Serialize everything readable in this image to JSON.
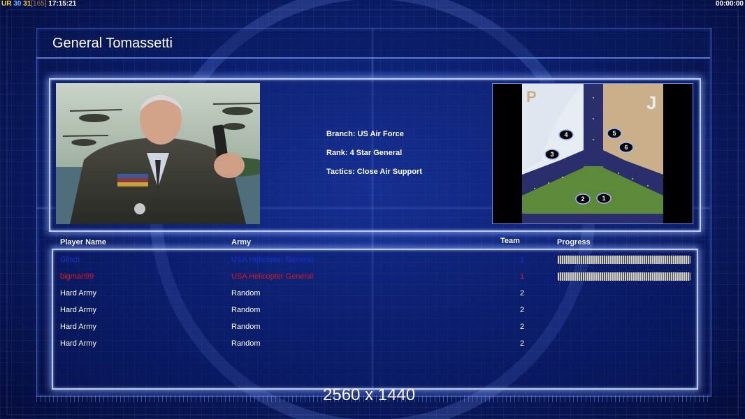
{
  "hud": {
    "ur": "UR",
    "n1": "30",
    "n2": "31",
    "n3": "[165]",
    "clock": "17:15:21",
    "timer": "00:00:00"
  },
  "title": "General Tomassetti",
  "general": {
    "branch": "Branch: US Air Force",
    "rank": "Rank: 4 Star General",
    "tactics": "Tactics: Close Air Support"
  },
  "map": {
    "label_left": "P",
    "label_right": "J",
    "spawns": [
      "1",
      "2",
      "3",
      "4",
      "5",
      "6"
    ]
  },
  "table": {
    "headers": {
      "player": "Player Name",
      "army": "Army",
      "team": "Team",
      "progress": "Progress"
    },
    "rows": [
      {
        "player": "Glitch",
        "army": "USA Helicopter General",
        "team": "1",
        "color": "#1c2fd6",
        "progress": 1.0
      },
      {
        "player": "bigman99",
        "army": "USA Helicopter General",
        "team": "1",
        "color": "#e01a1a",
        "progress": 1.0
      },
      {
        "player": "Hard Army",
        "army": "Random",
        "team": "2",
        "color": "#ffffff"
      },
      {
        "player": "Hard Army",
        "army": "Random",
        "team": "2",
        "color": "#ffffff"
      },
      {
        "player": "Hard Army",
        "army": "Random",
        "team": "2",
        "color": "#ffffff"
      },
      {
        "player": "Hard Army",
        "army": "Random",
        "team": "2",
        "color": "#ffffff"
      }
    ]
  },
  "resolution": "2560 x 1440"
}
